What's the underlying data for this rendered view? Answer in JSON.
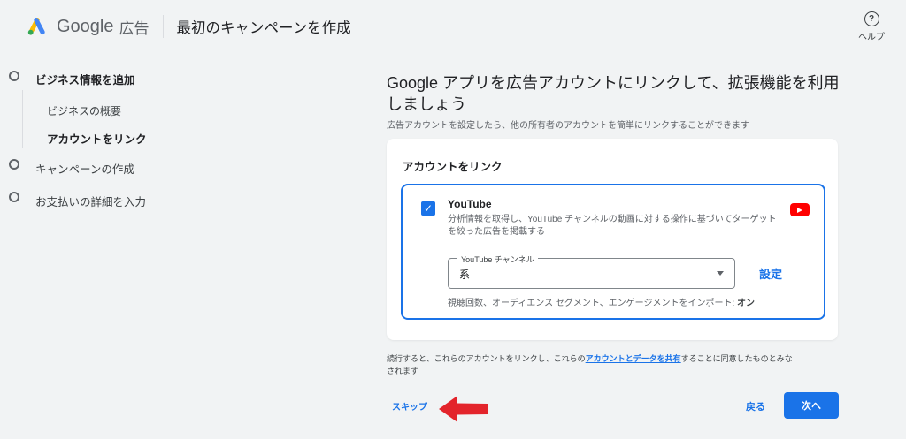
{
  "header": {
    "brand_google": "Google",
    "brand_product": "広告",
    "page_title": "最初のキャンペーンを作成",
    "help_icon": "?",
    "help_label": "ヘルプ"
  },
  "sidebar": {
    "steps": [
      {
        "label": "ビジネス情報を追加",
        "state": "active"
      },
      {
        "label": "キャンペーンの作成",
        "state": "upcoming"
      },
      {
        "label": "お支払いの詳細を入力",
        "state": "upcoming"
      }
    ],
    "substeps": [
      {
        "label": "ビジネスの概要",
        "state": "done"
      },
      {
        "label": "アカウントをリンク",
        "state": "current"
      }
    ]
  },
  "main": {
    "heading": "Google アプリを広告アカウントにリンクして、拡張機能を利用しましょう",
    "subheading": "広告アカウントを設定したら、他の所有者のアカウントを簡単にリンクすることができます",
    "card": {
      "title": "アカウントをリンク",
      "youtube": {
        "name": "YouTube",
        "checkbox_checked": true,
        "check_glyph": "✓",
        "description": "分析情報を取得し、YouTube チャンネルの動画に対する操作に基づいてターゲットを絞った広告を掲載する",
        "channel_label": "YouTube チャンネル",
        "channel_value": "系",
        "settings_label": "設定",
        "import_text": "視聴回数、オーディエンス セグメント、エンゲージメントをインポート: ",
        "import_value": "オン"
      }
    },
    "disclaimer": {
      "before_link": "続行すると、これらのアカウントをリンクし、これらの",
      "link": "アカウントとデータを共有",
      "after_link": "することに同意したものとみなされます"
    },
    "footer": {
      "skip_label": "スキップ",
      "back_label": "戻る",
      "next_label": "次へ"
    }
  },
  "colors": {
    "accent_blue": "#1a73e8",
    "background": "#f1f3f4",
    "text_dark": "#202124",
    "text_gray": "#5f6368",
    "youtube_red": "#ff0000",
    "annotation_red": "#e3242b",
    "logo_yellow": "#FBBC04",
    "logo_blue": "#4285F4",
    "logo_green": "#34A853"
  }
}
